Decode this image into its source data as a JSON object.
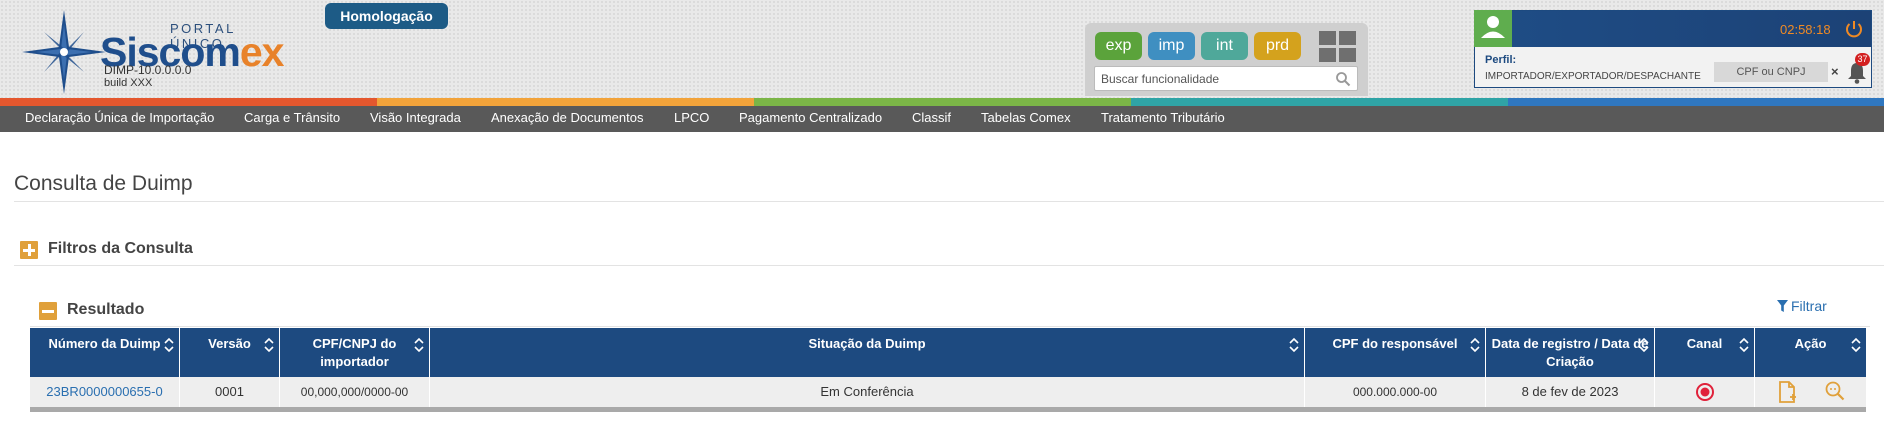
{
  "header": {
    "logo": {
      "portal_text": "PORTAL ÚNICO",
      "name_main": "Siscom",
      "name_accent": "ex",
      "version": "DIMP-10.0.0.0.0",
      "build": "build XXX"
    },
    "environment_badge": "Homologação",
    "modules": [
      {
        "label": "exp",
        "color": "#5ba33b"
      },
      {
        "label": "imp",
        "color": "#3f8fc1"
      },
      {
        "label": "int",
        "color": "#4fa89a"
      },
      {
        "label": "prd",
        "color": "#d4a21d"
      }
    ],
    "search": {
      "placeholder": "Buscar funcionalidade"
    },
    "user": {
      "timer": "02:58:18",
      "perfil_label": "Perfil:",
      "perfil_value": "IMPORTADOR/EXPORTADOR/DESPACHANTE",
      "cpf_placeholder": "CPF ou CNPJ",
      "clear_label": "×",
      "notification_count": "37"
    }
  },
  "stripe_colors": [
    "#e4572e",
    "#f2a33a",
    "#7bb547",
    "#2fa4a6",
    "#2f77c0"
  ],
  "nav": {
    "items": [
      "Declaração Única de Importação",
      "Carga e Trânsito",
      "Visão Integrada",
      "Anexação de Documentos",
      "LPCO",
      "Pagamento Centralizado",
      "Classif",
      "Tabelas Comex",
      "Tratamento Tributário"
    ]
  },
  "page": {
    "title": "Consulta de Duimp",
    "filters_section": "Filtros da Consulta",
    "result_section": "Resultado",
    "filter_link": "Filtrar"
  },
  "table": {
    "columns": [
      {
        "line1": "Número da Duimp",
        "line2": ""
      },
      {
        "line1": "Versão",
        "line2": ""
      },
      {
        "line1": "CPF/CNPJ do",
        "line2": "importador"
      },
      {
        "line1": "Situação da Duimp",
        "line2": ""
      },
      {
        "line1": "CPF do responsável",
        "line2": ""
      },
      {
        "line1": "Data de registro / Data de",
        "line2": "Criação"
      },
      {
        "line1": "Canal",
        "line2": ""
      },
      {
        "line1": "Ação",
        "line2": ""
      }
    ],
    "rows": [
      {
        "numero": "23BR0000000655-0",
        "versao": "0001",
        "cpf_cnpj": "00,000,000/0000-00",
        "situacao": "Em Conferência",
        "cpf_responsavel": "000.000.000-00",
        "data": "8 de fev de 2023",
        "canal_color": "#e0213a"
      }
    ]
  },
  "colors": {
    "brand_blue": "#1d4a80",
    "accent_orange": "#e8822a",
    "navbar": "#595959",
    "link": "#2a6fb0",
    "section_icon": "#e0a03a"
  }
}
